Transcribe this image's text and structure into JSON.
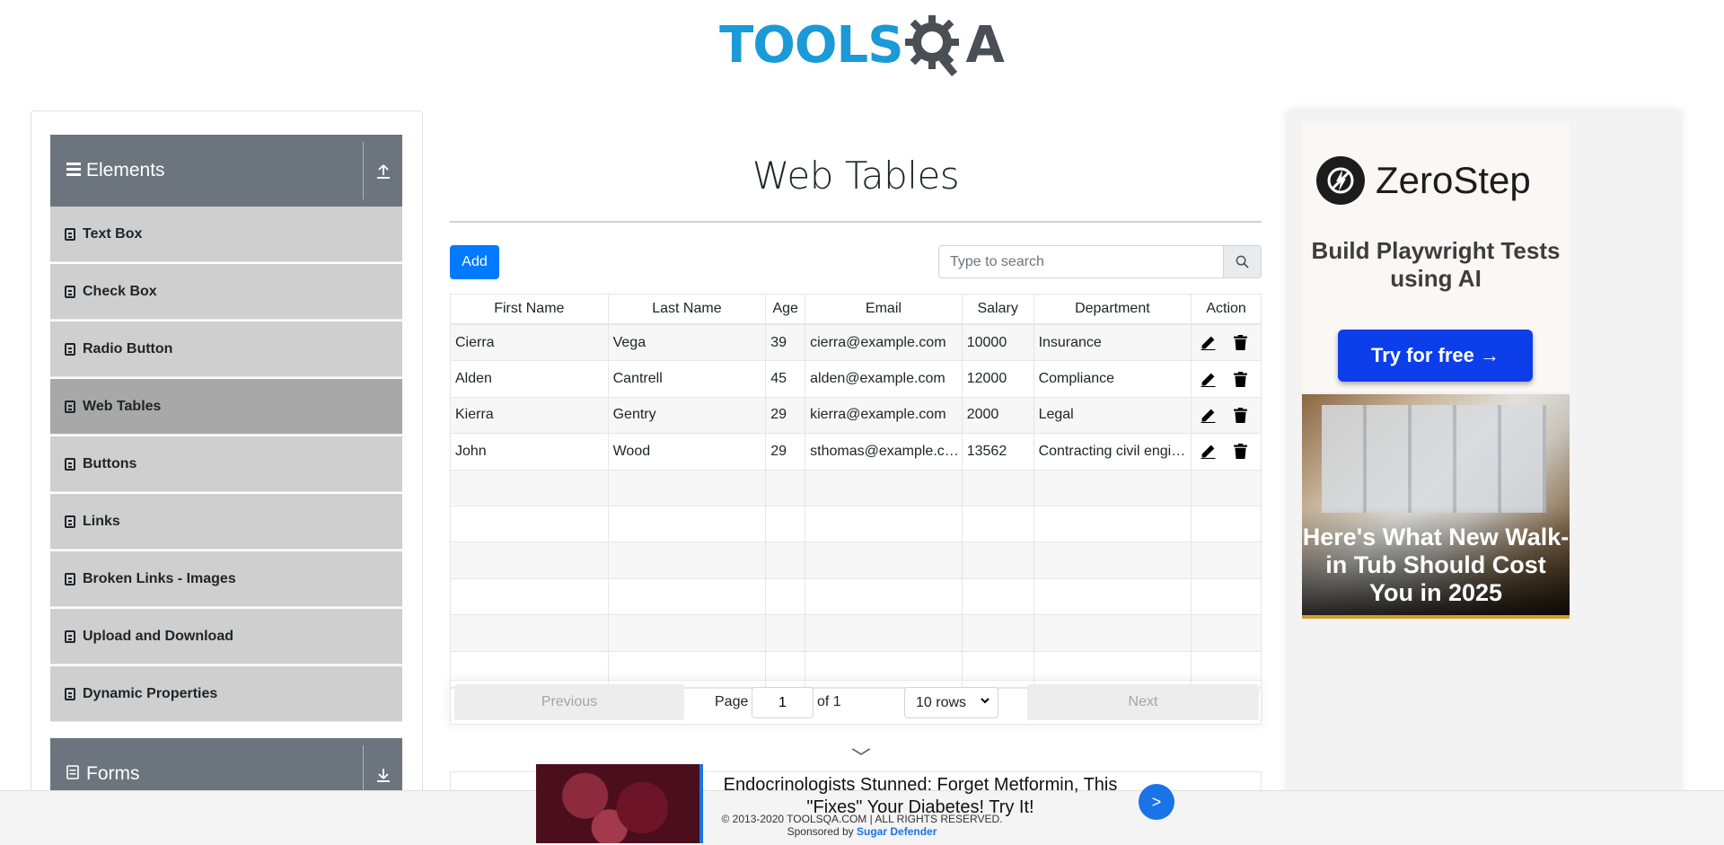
{
  "header": {
    "logo_text_left": "TOOLS",
    "logo_text_right": "A"
  },
  "sidebar": {
    "groups": [
      {
        "label": "Elements",
        "expanded": true
      },
      {
        "label": "Forms",
        "expanded": false
      }
    ],
    "items": [
      {
        "label": "Text Box"
      },
      {
        "label": "Check Box"
      },
      {
        "label": "Radio Button"
      },
      {
        "label": "Web Tables",
        "active": true
      },
      {
        "label": "Buttons"
      },
      {
        "label": "Links"
      },
      {
        "label": "Broken Links - Images"
      },
      {
        "label": "Upload and Download"
      },
      {
        "label": "Dynamic Properties"
      }
    ]
  },
  "main": {
    "title": "Web Tables",
    "add_label": "Add",
    "search_placeholder": "Type to search",
    "table": {
      "headers": [
        "First Name",
        "Last Name",
        "Age",
        "Email",
        "Salary",
        "Department",
        "Action"
      ],
      "rows": [
        [
          "Cierra",
          "Vega",
          "39",
          "cierra@example.com",
          "10000",
          "Insurance"
        ],
        [
          "Alden",
          "Cantrell",
          "45",
          "alden@example.com",
          "12000",
          "Compliance"
        ],
        [
          "Kierra",
          "Gentry",
          "29",
          "kierra@example.com",
          "2000",
          "Legal"
        ],
        [
          "John",
          "Wood",
          "29",
          "sthomas@example.com",
          "13562",
          "Contracting civil engineering"
        ]
      ],
      "empty_rows": 6
    },
    "pagination": {
      "previous_label": "Previous",
      "next_label": "Next",
      "page_label": "Page",
      "page_value": "1",
      "of_label": "of 1",
      "rows_option": "10 rows"
    }
  },
  "right_ad": {
    "brand": "ZeroStep",
    "tagline": "Build Playwright Tests using AI",
    "cta": "Try for free →",
    "secondary_headline": "Here's What New Walk-in Tub Should Cost You in 2025"
  },
  "bottom_ad": {
    "headline": "Endocrinologists Stunned: Forget Metformin, This \"Fixes\" Your Diabetes! Try It!",
    "go_label": ">",
    "copyright": "© 2013-2020 TOOLSQA.COM | ALL RIGHTS RESERVED.",
    "sponsored_prefix": "Sponsored by",
    "sponsor_name": "Sugar Defender"
  },
  "colors": {
    "primary": "#007bff",
    "logo_blue": "#1a9ad6",
    "sidebar_header": "#6c757d",
    "sidebar_item": "#cfcfcf",
    "sidebar_active": "#a8a8a8"
  }
}
